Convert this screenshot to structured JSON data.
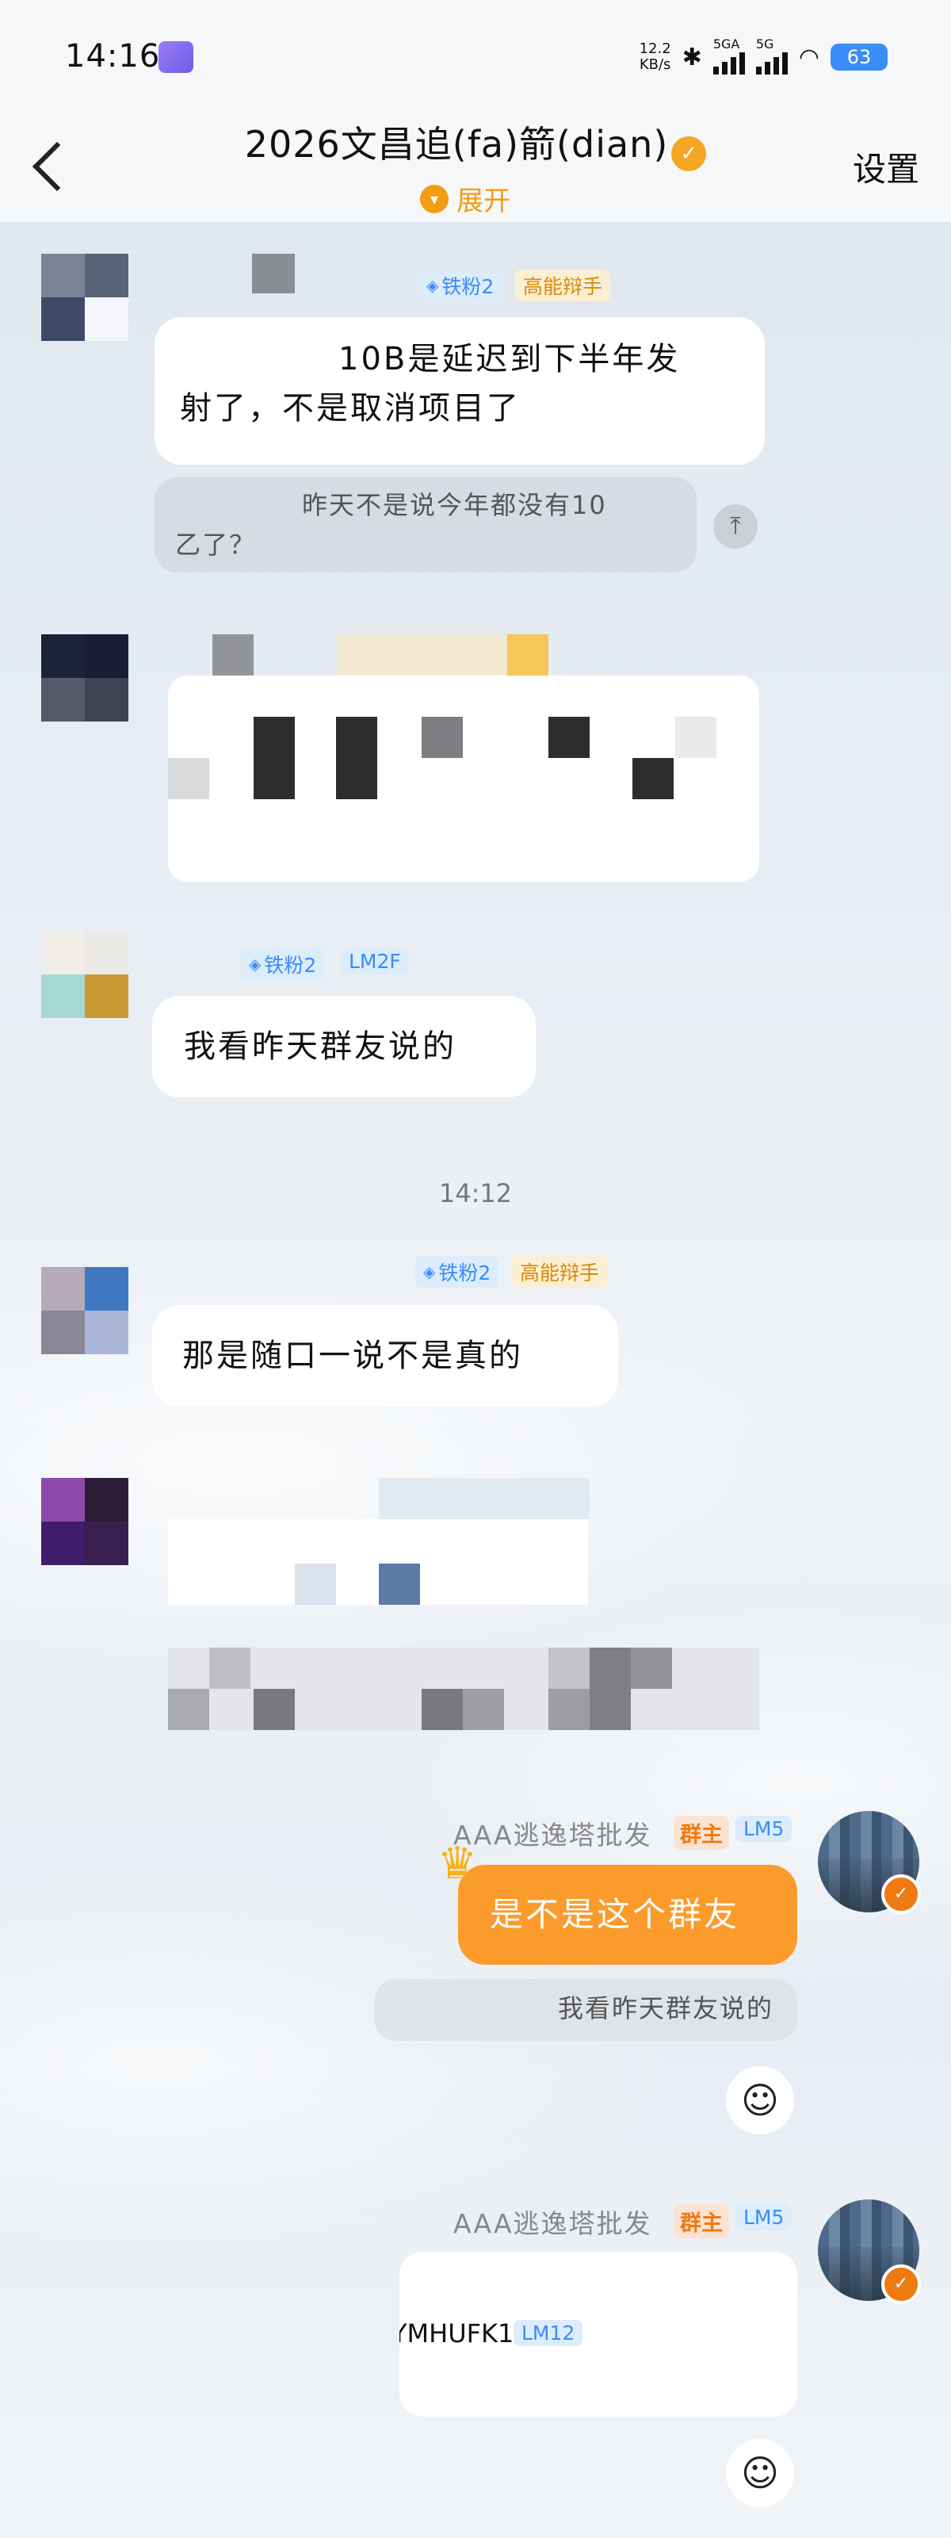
{
  "status_bar": {
    "time": "14:16",
    "speed_value": "12.2",
    "speed_unit": "KB/s",
    "signal1_label": "5GA",
    "signal2_label": "5G",
    "battery": "63"
  },
  "header": {
    "title": "2026文昌追(fa)箭(dian)",
    "expand_label": "展开",
    "settings_label": "设置"
  },
  "messages": [
    {
      "fan_badge": "铁粉2",
      "title_badge": "高能辩手",
      "text_line1": "10B是延迟到下半年发",
      "text_line2": "射了，不是取消项目了",
      "quote_line1": "昨天不是说今年都没有10",
      "quote_line2": "乙了？"
    },
    {
      "fan_badge": "铁粉2",
      "level_badge": "LM2F",
      "text": "我看昨天群友说的"
    },
    {
      "fan_badge": "铁粉2",
      "title_badge": "高能辩手",
      "text": "那是随口一说不是真的"
    }
  ],
  "timestamp": "14:12",
  "my_messages": [
    {
      "sender": "AAA逃逸塔批发",
      "owner_badge": "群主",
      "level_badge": "LM5",
      "text": "是不是这个群友",
      "quote": "我看昨天群友说的"
    },
    {
      "sender": "AAA逃逸塔批发",
      "owner_badge": "群主",
      "level_badge": "LM5",
      "card_name": "YMHUFK1",
      "card_level": "LM12"
    }
  ],
  "colors": {
    "accent_orange": "#fb9b2c",
    "badge_blue": "#3a8cf7",
    "badge_gold": "#d98a0a",
    "owner_orange": "#f07a12"
  }
}
